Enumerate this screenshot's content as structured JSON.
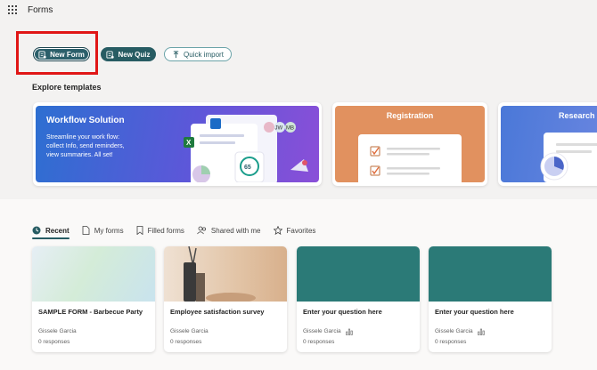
{
  "app": {
    "title": "Forms"
  },
  "actions": {
    "new_form": "New Form",
    "new_quiz": "New Quiz",
    "quick_import": "Quick import"
  },
  "templates": {
    "heading": "Explore templates",
    "workflow": {
      "title": "Workflow Solution",
      "description": "Streamline your work flow: collect Info, send reminders, view summaries. All set!",
      "avatars": [
        "JW",
        "MB"
      ],
      "stat": "65"
    },
    "registration": {
      "title": "Registration"
    },
    "research": {
      "title": "Research"
    }
  },
  "tabs": [
    {
      "label": "Recent",
      "icon": "clock-icon",
      "active": true
    },
    {
      "label": "My forms",
      "icon": "document-icon"
    },
    {
      "label": "Filled forms",
      "icon": "bookmark-icon"
    },
    {
      "label": "Shared with me",
      "icon": "people-icon"
    },
    {
      "label": "Favorites",
      "icon": "star-icon"
    }
  ],
  "forms": [
    {
      "title": "SAMPLE FORM - Barbecue Party",
      "owner": "Gissele Garcia",
      "responses": "0 responses",
      "thumb": "pastel"
    },
    {
      "title": "Employee satisfaction survey",
      "owner": "Gissele Garcia",
      "responses": "0 responses",
      "thumb": "photo"
    },
    {
      "title": "Enter your question here",
      "owner": "Gissele Garcia",
      "responses": "0 responses",
      "thumb": "teal"
    },
    {
      "title": "Enter your question here",
      "owner": "Gissele Garcia",
      "responses": "0 responses",
      "thumb": "teal"
    }
  ],
  "colors": {
    "accent": "#275c63",
    "highlight": "#e01616",
    "teal_thumb": "#2b7a77"
  }
}
